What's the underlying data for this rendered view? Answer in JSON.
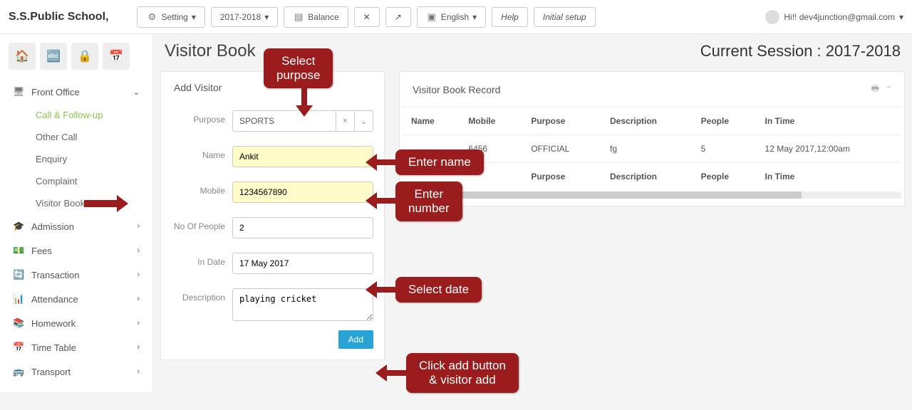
{
  "brand": "S.S.Public School,",
  "topbar": {
    "setting": "Setting",
    "year": "2017-2018",
    "balance": "Balance",
    "lang": "English",
    "help": "Help",
    "initial": "Initial setup"
  },
  "user": {
    "greeting": "Hi!! dev4junction@gmail.com"
  },
  "sidebar": {
    "frontoffice": "Front Office",
    "subs": {
      "call_followup": "Call & Follow-up",
      "other_call": "Other Call",
      "enquiry": "Enquiry",
      "complaint": "Complaint",
      "visitor_book": "Visitor Book"
    },
    "admission": "Admission",
    "fees": "Fees",
    "transaction": "Transaction",
    "attendance": "Attendance",
    "homework": "Homework",
    "time_table": "Time Table",
    "transport": "Transport"
  },
  "page": {
    "title": "Visitor Book",
    "session": "Current Session : 2017-2018"
  },
  "addvisitor": {
    "heading": "Add Visitor",
    "labels": {
      "purpose": "Purpose",
      "name": "Name",
      "mobile": "Mobile",
      "no_people": "No Of People",
      "in_date": "In Date",
      "description": "Description"
    },
    "values": {
      "purpose": "SPORTS",
      "name": "Ankit",
      "mobile": "1234567890",
      "no_people": "2",
      "in_date": "17 May 2017",
      "description": "playing cricket"
    },
    "add_btn": "Add"
  },
  "record": {
    "heading": "Visitor Book Record",
    "headers": {
      "name": "Name",
      "mobile": "Mobile",
      "purpose": "Purpose",
      "description": "Description",
      "people": "People",
      "in_time": "In Time"
    },
    "row1": {
      "mobile": "6456",
      "purpose": "OFFICIAL",
      "description": "fg",
      "people": "5",
      "in_time": "12 May 2017,12:00am"
    }
  },
  "callouts": {
    "select_purpose": "Select\npurpose",
    "enter_name": "Enter name",
    "enter_number": "Enter\nnumber",
    "select_date": "Select date",
    "click_add": "Click add button\n& visitor add"
  }
}
